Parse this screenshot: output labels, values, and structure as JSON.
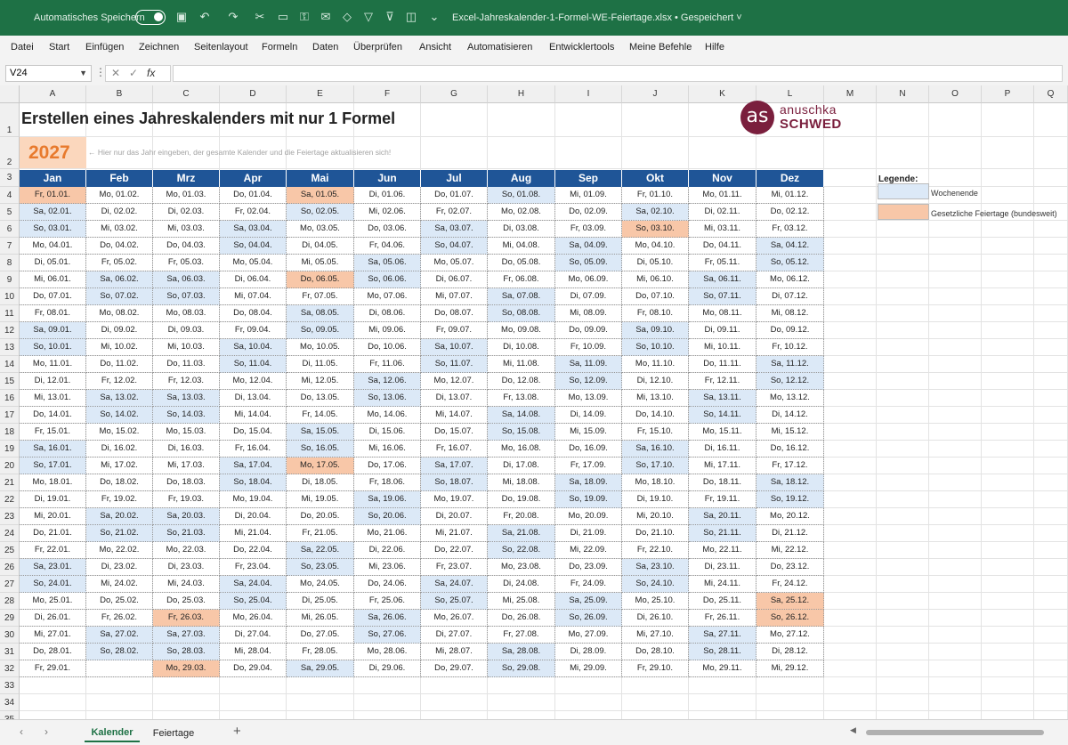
{
  "titlebar": {
    "autosave_label": "Automatisches Speichern",
    "file_title": "Excel-Jahreskalender-1-Formel-WE-Feiertage.xlsx • Gespeichert ˅",
    "icons": [
      "save-icon",
      "undo-icon",
      "redo-icon",
      "cut-icon",
      "open-icon",
      "lock-icon",
      "mail-icon",
      "format-icon",
      "filter-icon",
      "screenshot-icon",
      "more-icon"
    ]
  },
  "menu": [
    "Datei",
    "Start",
    "Einfügen",
    "Zeichnen",
    "Seitenlayout",
    "Formeln",
    "Daten",
    "Überprüfen",
    "Ansicht",
    "Automatisieren",
    "Entwicklertools",
    "Meine Befehle",
    "Hilfe"
  ],
  "formula_bar": {
    "name_box": "V24",
    "fx_label": "fx",
    "formula": ""
  },
  "columns": [
    "A",
    "B",
    "C",
    "D",
    "E",
    "F",
    "G",
    "H",
    "I",
    "J",
    "K",
    "L",
    "M",
    "N",
    "O",
    "P",
    "Q"
  ],
  "rows": [
    "1",
    "2",
    "3",
    "4",
    "5",
    "6",
    "7",
    "8",
    "9",
    "10",
    "11",
    "12",
    "13",
    "14",
    "15",
    "16",
    "17",
    "18",
    "19",
    "20",
    "21",
    "22",
    "23",
    "24",
    "25",
    "26",
    "27",
    "28",
    "29",
    "30",
    "31",
    "32",
    "33",
    "34",
    "35"
  ],
  "sheet": {
    "title": "Erstellen eines Jahreskalenders mit nur 1 Formel",
    "year": "2027",
    "hint": "← Hier nur das Jahr eingeben, der gesamte Kalender und die Feiertage aktualisieren sich!"
  },
  "logo": {
    "mark": "as",
    "name": "anuschka",
    "surname": "SCHWED"
  },
  "calendar": {
    "months": [
      "Jan",
      "Feb",
      "Mrz",
      "Apr",
      "Mai",
      "Jun",
      "Jul",
      "Aug",
      "Sep",
      "Okt",
      "Nov",
      "Dez"
    ],
    "year": 2027,
    "weekday_abbr": [
      "So",
      "Mo",
      "Di",
      "Mi",
      "Do",
      "Fr",
      "Sa"
    ],
    "holidays": [
      "01.01.",
      "26.03.",
      "29.03.",
      "01.05.",
      "06.05.",
      "17.05.",
      "03.10.",
      "25.12.",
      "26.12."
    ]
  },
  "legend": {
    "title": "Legende:",
    "weekend": "Wochenende",
    "holiday": "Gesetzliche Feiertage (bundesweit)"
  },
  "colors": {
    "header_blue": "#1f5597",
    "weekend": "#dce9f7",
    "holiday": "#f8c7a8",
    "excel_green": "#1e7145"
  },
  "tabs": {
    "active": "Kalender",
    "other": "Feiertage",
    "add": "+"
  }
}
